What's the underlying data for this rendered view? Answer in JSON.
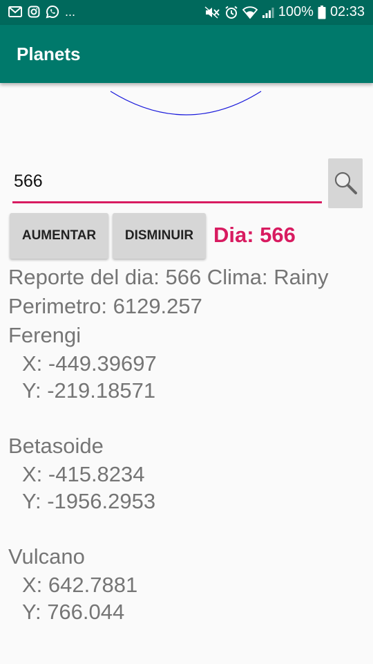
{
  "status_bar": {
    "left_icons": [
      "gmail-icon",
      "instagram-icon",
      "whatsapp-icon"
    ],
    "overflow": "...",
    "right_icons": [
      "mute-icon",
      "alarm-icon",
      "wifi-icon",
      "signal-icon"
    ],
    "battery": "100%",
    "time": "02:33"
  },
  "app_bar": {
    "title": "Planets"
  },
  "orbit": {
    "stroke_color": "#1a1adb"
  },
  "input": {
    "value": "566"
  },
  "buttons": {
    "increase": "AUMENTAR",
    "decrease": "DISMINUIR"
  },
  "day_label": "Dia: 566",
  "report": {
    "summary": "Reporte del dia: 566 Clima: Rainy",
    "perimeter": "Perimetro: 6129.257",
    "planets": [
      {
        "name": "Ferengi",
        "x": "X: -449.39697",
        "y": "Y: -219.18571"
      },
      {
        "name": "Betasoide",
        "x": "X: -415.8234",
        "y": "Y: -1956.2953"
      },
      {
        "name": "Vulcano",
        "x": "X: 642.7881",
        "y": "Y: 766.044"
      }
    ]
  },
  "colors": {
    "status_bar": "#00695c",
    "app_bar": "#00796b",
    "accent": "#d81b60",
    "report_text": "#757575"
  }
}
